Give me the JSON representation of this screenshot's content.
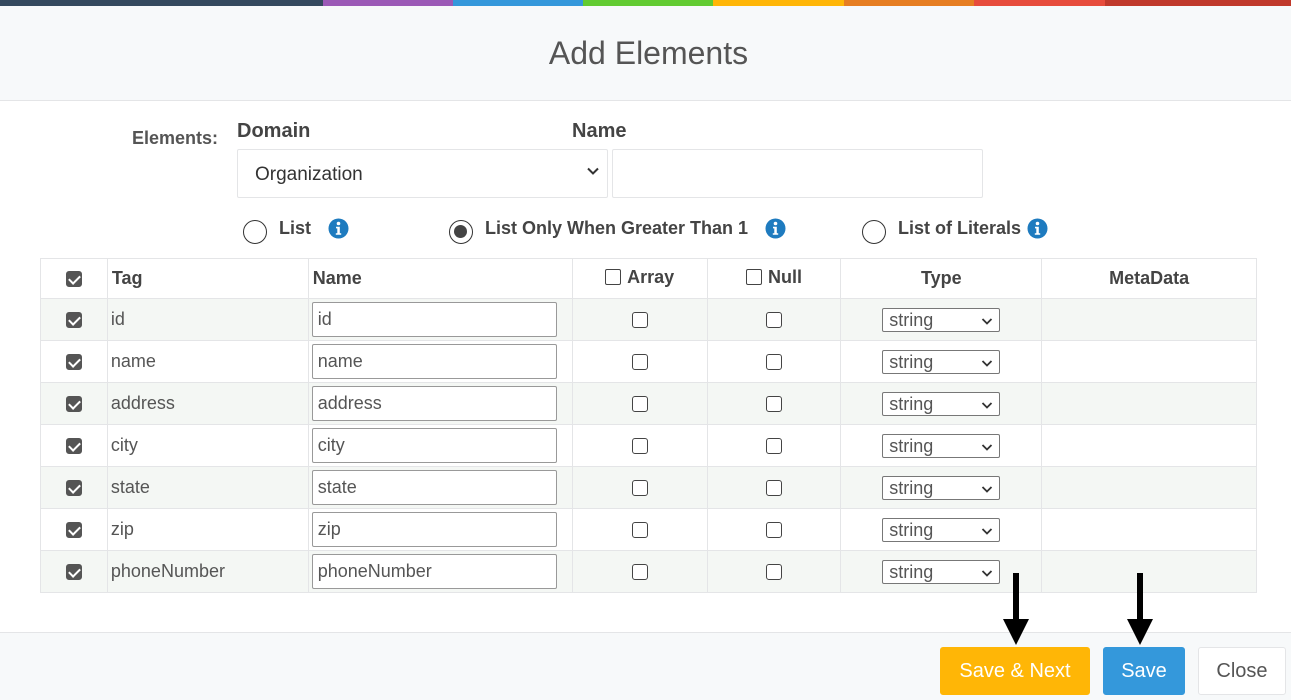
{
  "colors": {
    "rainbow": [
      "#34495e",
      "#9b59b6",
      "#3498db",
      "#62cb31",
      "#ffb606",
      "#e67e22",
      "#e74c3c",
      "#c0392b"
    ],
    "accent_primary": "#3498db",
    "accent_warning": "#ffb606"
  },
  "header": {
    "title": "Add Elements"
  },
  "form": {
    "elements_label": "Elements:",
    "domain_label": "Domain",
    "name_label": "Name",
    "domain_value": "Organization",
    "name_value": "",
    "list_options": [
      {
        "label": "List",
        "checked": false,
        "icon": "info-icon"
      },
      {
        "label": "List Only When Greater Than 1",
        "checked": true,
        "icon": "info-icon"
      },
      {
        "label": "List of Literals",
        "checked": false,
        "icon": "info-icon"
      }
    ]
  },
  "table": {
    "headers": {
      "select_all_checked": true,
      "tag": "Tag",
      "name": "Name",
      "array": "Array",
      "null": "Null",
      "type": "Type",
      "metadata": "MetaData"
    },
    "rows": [
      {
        "checked": true,
        "tag": "id",
        "name": "id",
        "array": false,
        "null": false,
        "type": "string",
        "metadata": ""
      },
      {
        "checked": true,
        "tag": "name",
        "name": "name",
        "array": false,
        "null": false,
        "type": "string",
        "metadata": ""
      },
      {
        "checked": true,
        "tag": "address",
        "name": "address",
        "array": false,
        "null": false,
        "type": "string",
        "metadata": ""
      },
      {
        "checked": true,
        "tag": "city",
        "name": "city",
        "array": false,
        "null": false,
        "type": "string",
        "metadata": ""
      },
      {
        "checked": true,
        "tag": "state",
        "name": "state",
        "array": false,
        "null": false,
        "type": "string",
        "metadata": ""
      },
      {
        "checked": true,
        "tag": "zip",
        "name": "zip",
        "array": false,
        "null": false,
        "type": "string",
        "metadata": ""
      },
      {
        "checked": true,
        "tag": "phoneNumber",
        "name": "phoneNumber",
        "array": false,
        "null": false,
        "type": "string",
        "metadata": ""
      }
    ]
  },
  "footer": {
    "save_next_label": "Save & Next",
    "save_label": "Save",
    "close_label": "Close"
  }
}
